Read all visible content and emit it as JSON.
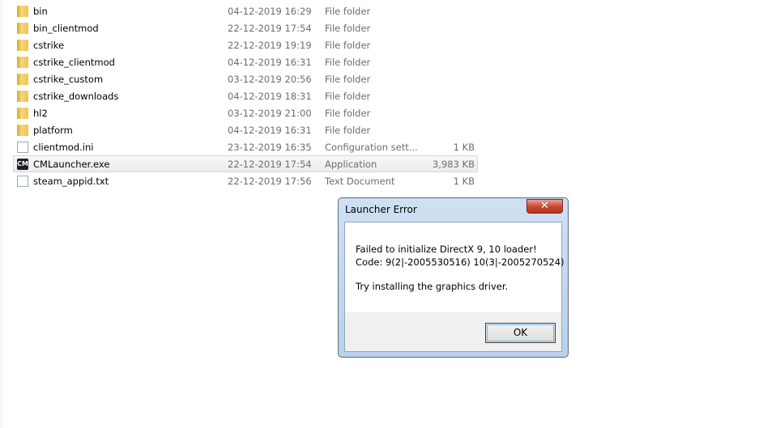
{
  "files": [
    {
      "name": "bin",
      "date": "04-12-2019 16:29",
      "type": "File folder",
      "size": "",
      "icon": "folder"
    },
    {
      "name": "bin_clientmod",
      "date": "22-12-2019 17:54",
      "type": "File folder",
      "size": "",
      "icon": "folder"
    },
    {
      "name": "cstrike",
      "date": "22-12-2019 19:19",
      "type": "File folder",
      "size": "",
      "icon": "folder"
    },
    {
      "name": "cstrike_clientmod",
      "date": "04-12-2019 16:31",
      "type": "File folder",
      "size": "",
      "icon": "folder"
    },
    {
      "name": "cstrike_custom",
      "date": "03-12-2019 20:56",
      "type": "File folder",
      "size": "",
      "icon": "folder"
    },
    {
      "name": "cstrike_downloads",
      "date": "04-12-2019 18:31",
      "type": "File folder",
      "size": "",
      "icon": "folder"
    },
    {
      "name": "hl2",
      "date": "03-12-2019 21:00",
      "type": "File folder",
      "size": "",
      "icon": "folder"
    },
    {
      "name": "platform",
      "date": "04-12-2019 16:31",
      "type": "File folder",
      "size": "",
      "icon": "folder"
    },
    {
      "name": "clientmod.ini",
      "date": "23-12-2019 16:35",
      "type": "Configuration sett...",
      "size": "1 KB",
      "icon": "config-file"
    },
    {
      "name": "CMLauncher.exe",
      "date": "22-12-2019 17:54",
      "type": "Application",
      "size": "3,983 KB",
      "icon": "cm-app",
      "selected": true
    },
    {
      "name": "steam_appid.txt",
      "date": "22-12-2019 17:56",
      "type": "Text Document",
      "size": "1 KB",
      "icon": "text-file"
    }
  ],
  "dialog": {
    "title": "Launcher Error",
    "close": "✕",
    "line1": "Failed to initialize DirectX 9, 10 loader!",
    "line2": "Code: 9(2|-2005530516) 10(3|-2005270524)",
    "line3": "Try installing the graphics driver.",
    "ok": "OK",
    "cm_icon_text": "CM"
  }
}
